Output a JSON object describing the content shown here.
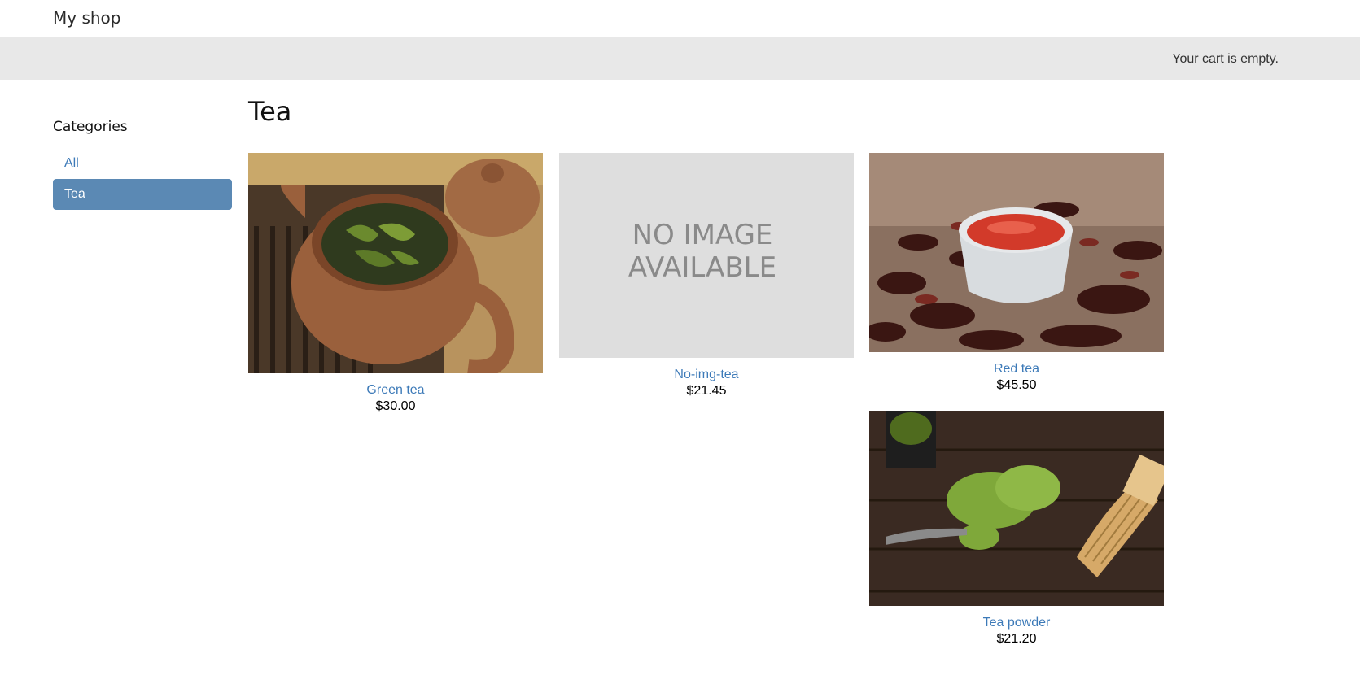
{
  "header": {
    "brand": "My shop"
  },
  "cart": {
    "status": "Your cart is empty."
  },
  "sidebar": {
    "title": "Categories",
    "items": [
      {
        "label": "All",
        "active": false
      },
      {
        "label": "Tea",
        "active": true
      }
    ]
  },
  "main": {
    "title": "Tea",
    "products": [
      {
        "name": "Green tea",
        "price": "$30.00",
        "image": "green-tea-teapot"
      },
      {
        "name": "No-img-tea",
        "price": "$21.45",
        "image": "no-image-placeholder",
        "placeholder_line1": "NO IMAGE",
        "placeholder_line2": "AVAILABLE"
      },
      {
        "name": "Red tea",
        "price": "$45.50",
        "image": "red-tea-cup"
      },
      {
        "name": "Tea powder",
        "price": "$21.20",
        "image": "matcha-powder-whisk"
      }
    ]
  },
  "colors": {
    "link": "#3d7ab8",
    "active_bg": "#5b89b4",
    "cartbar_bg": "#e8e8e8"
  }
}
